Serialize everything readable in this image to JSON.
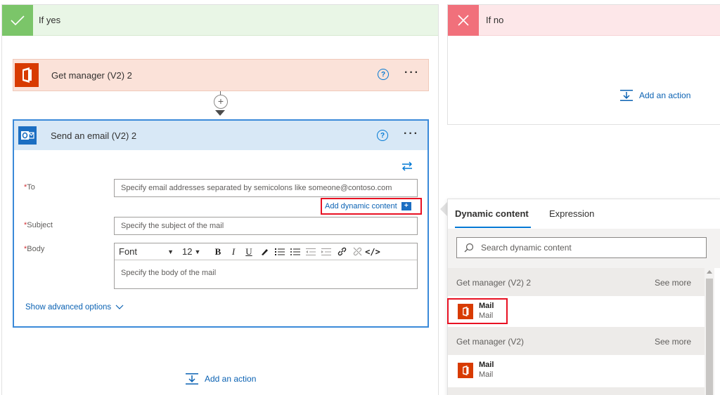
{
  "yes_branch": {
    "title": "If yes",
    "add_action_label": "Add an action"
  },
  "no_branch": {
    "title": "If no",
    "add_action_label": "Add an action"
  },
  "get_manager_card": {
    "title": "Get manager (V2) 2",
    "help": "?",
    "more": "···"
  },
  "connector": {
    "plus": "+"
  },
  "send_email_card": {
    "title": "Send an email (V2) 2",
    "help": "?",
    "more": "···",
    "to": {
      "label": "To",
      "required_mark": "*",
      "placeholder": "Specify email addresses separated by semicolons like someone@contoso.com"
    },
    "add_dynamic_content": "Add dynamic content",
    "subject": {
      "label": "Subject",
      "required_mark": "*",
      "placeholder": "Specify the subject of the mail"
    },
    "body": {
      "label": "Body",
      "required_mark": "*",
      "font": "Font",
      "font_size": "12",
      "placeholder": "Specify the body of the mail"
    },
    "show_advanced": "Show advanced options"
  },
  "dynamic_panel": {
    "tabs": [
      "Dynamic content",
      "Expression"
    ],
    "active_tab": "Dynamic content",
    "search_placeholder": "Search dynamic content",
    "groups": [
      {
        "name": "Get manager (V2) 2",
        "see_more": "See more",
        "items": [
          {
            "title": "Mail",
            "subtitle": "Mail",
            "highlighted": true
          }
        ]
      },
      {
        "name": "Get manager (V2)",
        "see_more": "See more",
        "items": [
          {
            "title": "Mail",
            "subtitle": "Mail",
            "highlighted": false
          }
        ]
      }
    ]
  },
  "colors": {
    "yes_accent": "#7bc569",
    "no_accent": "#f1707b",
    "office_orange": "#d83b01",
    "outlook_blue": "#1b6ec2",
    "link_blue": "#0b62b3",
    "highlight_red": "#e81123"
  },
  "icons": {
    "yes": "check-icon",
    "no": "close-icon",
    "add_action": "add-action-icon",
    "swap": "swap-icon",
    "search": "search-icon"
  }
}
